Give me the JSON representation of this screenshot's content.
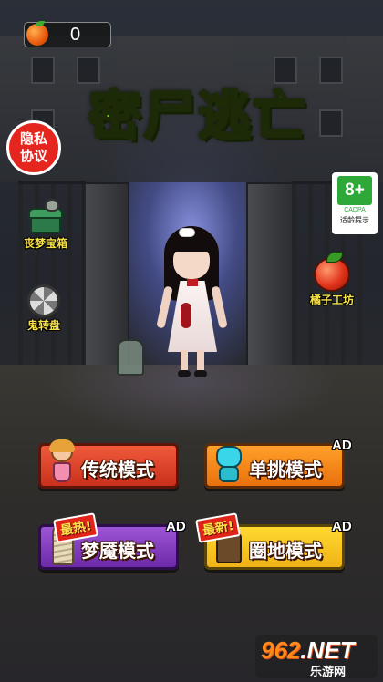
{
  "hud": {
    "orange_count": "0"
  },
  "title": "密尸逃亡",
  "privacy": {
    "line1": "隐私",
    "line2": "协议"
  },
  "age_rating": {
    "badge": "8+",
    "org": "CADPA",
    "tip": "适龄提示"
  },
  "side_menu": {
    "left": [
      {
        "label": "丧梦宝箱",
        "icon": "zombie-chest-icon"
      },
      {
        "label": "鬼转盘",
        "icon": "ghost-wheel-icon"
      }
    ],
    "right": [
      {
        "label": "橘子工坊",
        "icon": "orange-workshop-icon"
      }
    ]
  },
  "modes": [
    {
      "label": "传统模式",
      "ad": "",
      "tag": "",
      "icon": "doll-icon",
      "color": "#e2462b"
    },
    {
      "label": "单挑模式",
      "ad": "AD",
      "tag": "",
      "icon": "cyan-monster-icon",
      "color": "#f78a1c"
    },
    {
      "label": "梦魇模式",
      "ad": "AD",
      "tag": "最热!",
      "icon": "mummy-icon",
      "color": "#8545c4"
    },
    {
      "label": "圈地模式",
      "ad": "AD",
      "tag": "最新!",
      "icon": "stump-icon",
      "color": "#f6c622"
    }
  ],
  "watermark": {
    "brand_num": "962",
    "brand_suffix": ".NET",
    "sub": "乐游网"
  }
}
